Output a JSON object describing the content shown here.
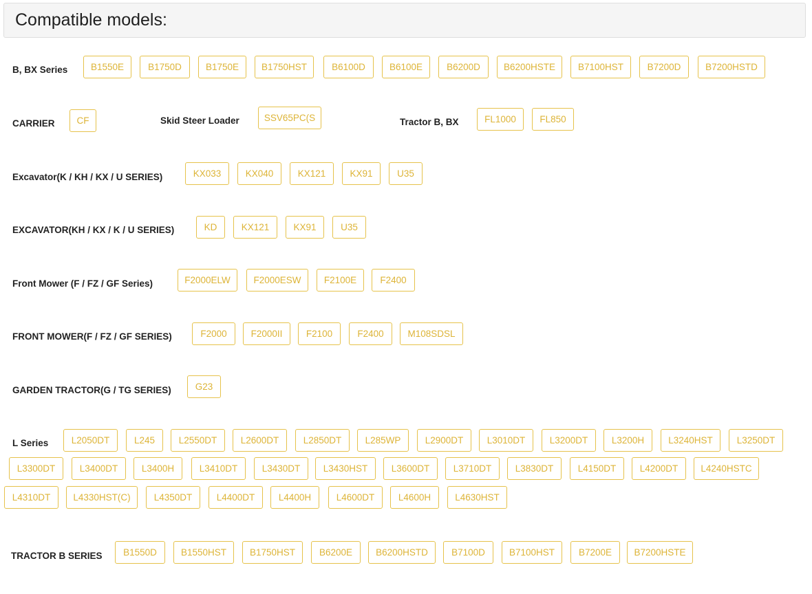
{
  "header": {
    "title": "Compatible models:"
  },
  "groups": [
    {
      "label": "B, BX Series",
      "models": [
        "B1550E",
        "B1750D",
        "B1750E",
        "B1750HST",
        "B6100D",
        "B6100E",
        "B6200D",
        "B6200HSTE",
        "B7100HST",
        "B7200D",
        "B7200HSTD"
      ]
    },
    {
      "label": "CARRIER",
      "models": [
        "CF"
      ]
    },
    {
      "label": "Skid Steer Loader",
      "models": [
        "SSV65PC(S"
      ]
    },
    {
      "label": "Tractor B, BX",
      "models": [
        "FL1000",
        "FL850"
      ]
    },
    {
      "label": "Excavator(K / KH / KX / U SERIES)",
      "models": [
        "KX033",
        "KX040",
        "KX121",
        "KX91",
        "U35"
      ]
    },
    {
      "label": "EXCAVATOR(KH / KX / K / U SERIES)",
      "models": [
        "KD",
        "KX121",
        "KX91",
        "U35"
      ]
    },
    {
      "label": "Front Mower (F / FZ / GF Series)",
      "models": [
        "F2000ELW",
        "F2000ESW",
        "F2100E",
        "F2400"
      ]
    },
    {
      "label": "FRONT MOWER(F / FZ / GF SERIES)",
      "models": [
        "F2000",
        "F2000II",
        "F2100",
        "F2400",
        "M108SDSL"
      ]
    },
    {
      "label": "GARDEN TRACTOR(G / TG SERIES)",
      "models": [
        "G23"
      ]
    },
    {
      "label": "L Series",
      "models": [
        "L2050DT",
        "L245",
        "L2550DT",
        "L2600DT",
        "L2850DT",
        "L285WP",
        "L2900DT",
        "L3010DT",
        "L3200DT",
        "L3200H",
        "L3240HST",
        "L3250DT",
        "L3300DT",
        "L3400DT",
        "L3400H",
        "L3410DT",
        "L3430DT",
        "L3430HST",
        "L3600DT",
        "L3710DT",
        "L3830DT",
        "L4150DT",
        "L4200DT",
        "L4240HSTC",
        "L4310DT",
        "L4330HST(C)",
        "L4350DT",
        "L4400DT",
        "L4400H",
        "L4600DT",
        "L4600H",
        "L4630HST"
      ]
    },
    {
      "label": "TRACTOR B SERIES",
      "models": [
        "B1550D",
        "B1550HST",
        "B1750HST",
        "B6200E",
        "B6200HSTD",
        "B7100D",
        "B7100HST",
        "B7200E",
        "B7200HSTE"
      ]
    }
  ]
}
